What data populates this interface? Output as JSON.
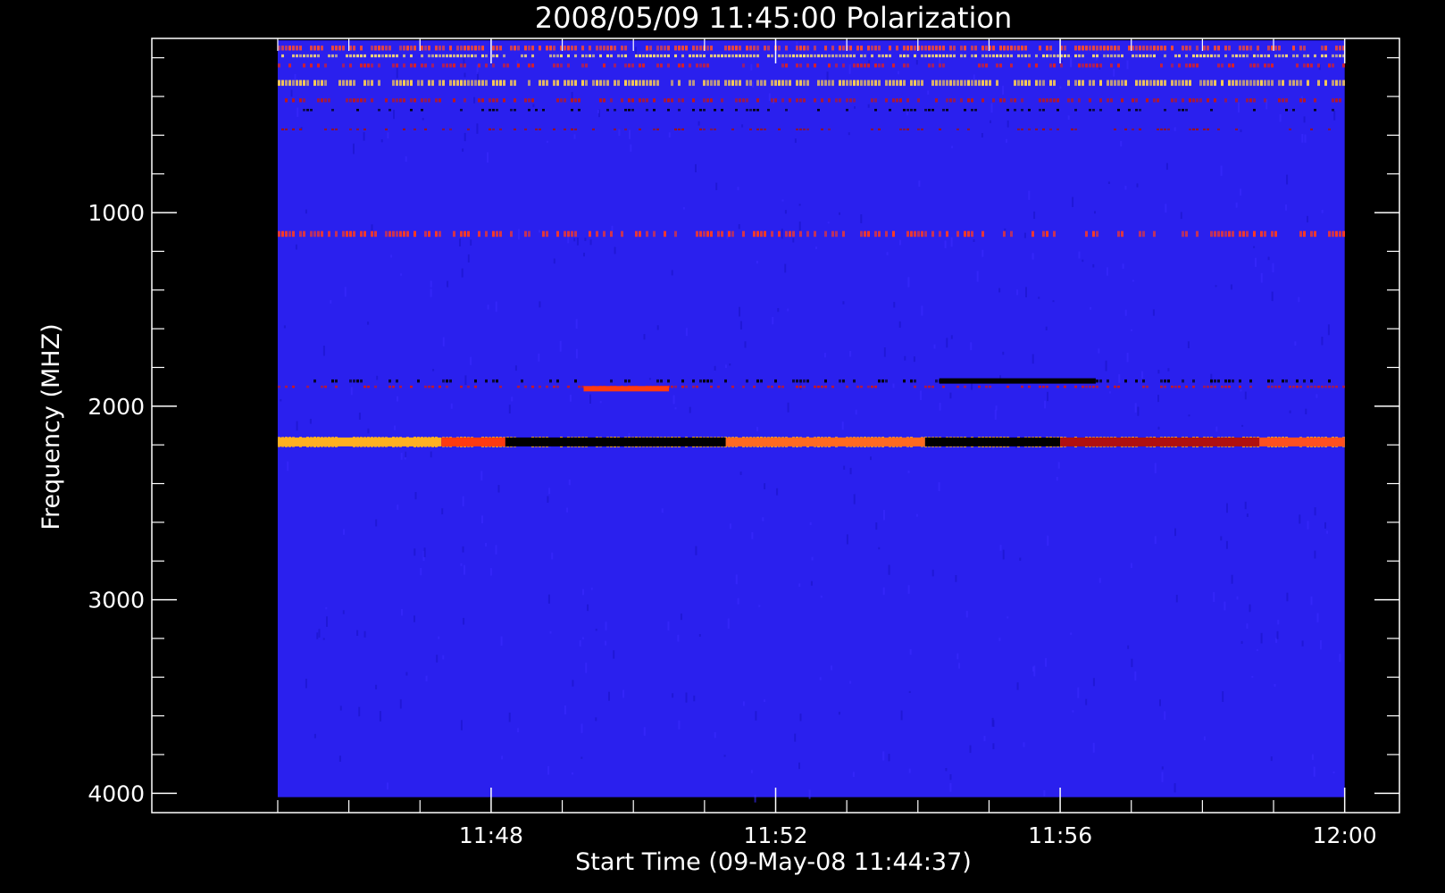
{
  "chart_data": {
    "type": "heatmap",
    "title": "2008/05/09 11:45:00 Polarization",
    "xlabel": "Start Time (09-May-08 11:44:37)",
    "ylabel": "Frequency (MHZ)",
    "x_ticks": [
      {
        "label": "11:48",
        "minutes": 3
      },
      {
        "label": "11:52",
        "minutes": 7
      },
      {
        "label": "11:56",
        "minutes": 11
      },
      {
        "label": "12:00",
        "minutes": 15
      }
    ],
    "y_ticks": [
      {
        "label": "1000",
        "value": 1000
      },
      {
        "label": "2000",
        "value": 2000
      },
      {
        "label": "3000",
        "value": 3000
      },
      {
        "label": "4000",
        "value": 4000
      }
    ],
    "xlim_minutes": [
      -1.77,
      15.77
    ],
    "ylim": [
      4100,
      100
    ],
    "data_extent": {
      "minutes": [
        0,
        15
      ],
      "frequency": [
        110,
        4020
      ]
    },
    "background_color": "#2a20ee",
    "bands": [
      {
        "freq": 150,
        "width": 25,
        "intensity": "high",
        "color": "#ff4b2b"
      },
      {
        "freq": 190,
        "width": 15,
        "intensity": "high",
        "color": "#ffe070"
      },
      {
        "freq": 240,
        "width": 20,
        "intensity": "medium",
        "color": "#e02020"
      },
      {
        "freq": 330,
        "width": 30,
        "intensity": "high",
        "color": "#ffd050"
      },
      {
        "freq": 420,
        "width": 20,
        "intensity": "medium",
        "color": "#c01818"
      },
      {
        "freq": 470,
        "width": 12,
        "intensity": "low",
        "color": "#000000"
      },
      {
        "freq": 570,
        "width": 10,
        "intensity": "low",
        "color": "#a01010"
      },
      {
        "freq": 1110,
        "width": 30,
        "intensity": "medium",
        "color": "#ff3a20"
      },
      {
        "freq": 1870,
        "width": 16,
        "intensity": "low",
        "color": "#000000"
      },
      {
        "freq": 1900,
        "width": 12,
        "intensity": "medium",
        "color": "#d01818"
      },
      {
        "freq": 2185,
        "width": 55,
        "intensity": "high",
        "color": "#ffb020"
      }
    ],
    "segments": [
      {
        "freq": 2185,
        "from_min": 0,
        "to_min": 2.3,
        "color": "#ffb020"
      },
      {
        "freq": 2185,
        "from_min": 2.3,
        "to_min": 3.2,
        "color": "#ff3a10"
      },
      {
        "freq": 2185,
        "from_min": 3.2,
        "to_min": 6.3,
        "color": "#000000"
      },
      {
        "freq": 2185,
        "from_min": 6.3,
        "to_min": 9.1,
        "color": "#ff6a20"
      },
      {
        "freq": 2185,
        "from_min": 9.1,
        "to_min": 11.0,
        "color": "#000000"
      },
      {
        "freq": 2185,
        "from_min": 11.0,
        "to_min": 13.8,
        "color": "#b01010"
      },
      {
        "freq": 2185,
        "from_min": 13.8,
        "to_min": 15.0,
        "color": "#ff5020"
      },
      {
        "freq": 1910,
        "from_min": 4.3,
        "to_min": 5.5,
        "color": "#ff3a10"
      },
      {
        "freq": 1870,
        "from_min": 9.3,
        "to_min": 11.5,
        "color": "#000000"
      }
    ]
  }
}
